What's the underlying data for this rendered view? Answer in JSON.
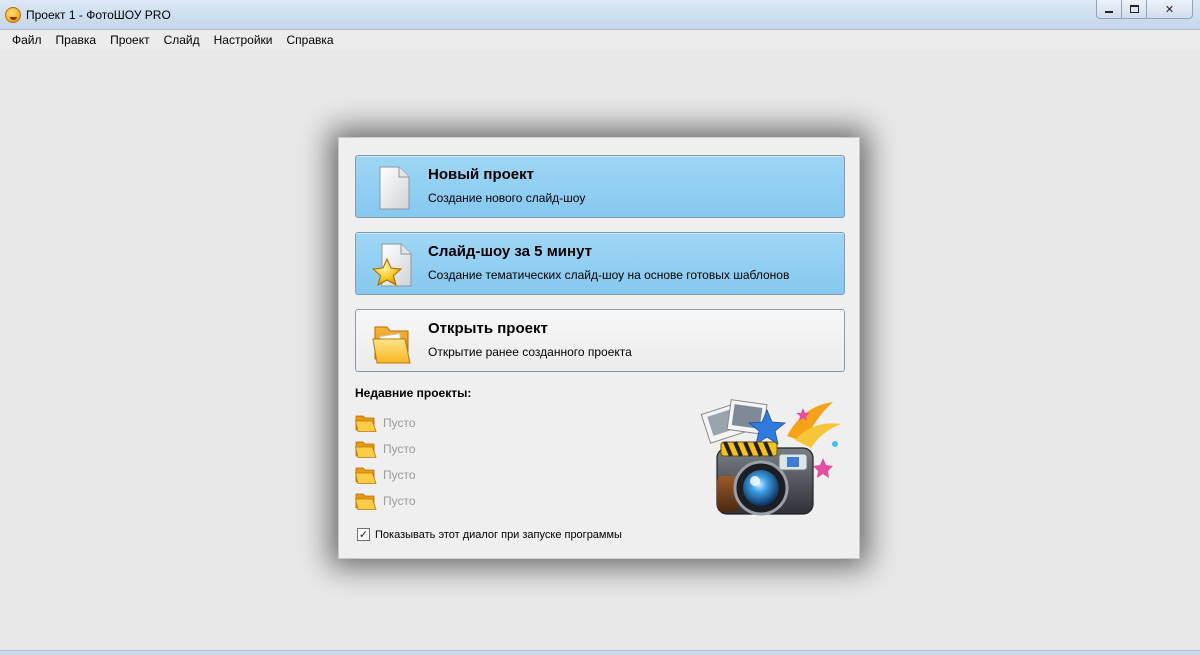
{
  "window": {
    "title": "Проект 1 - ФотоШОУ PRO",
    "controls": {
      "minimize": "minimize-icon",
      "maximize": "maximize-icon",
      "close": "✕"
    }
  },
  "menu": [
    "Файл",
    "Правка",
    "Проект",
    "Слайд",
    "Настройки",
    "Справка"
  ],
  "dialog": {
    "actions": [
      {
        "title": "Новый проект",
        "subtitle": "Создание нового слайд-шоу",
        "icon": "blank-document-icon"
      },
      {
        "title": "Слайд-шоу за 5 минут",
        "subtitle": "Создание тематических слайд-шоу на основе готовых шаблонов",
        "icon": "star-document-icon"
      },
      {
        "title": "Открыть проект",
        "subtitle": "Открытие ранее созданного проекта",
        "icon": "open-folder-icon"
      }
    ],
    "recent": {
      "heading": "Недавние проекты:",
      "items": [
        "Пусто",
        "Пусто",
        "Пусто",
        "Пусто"
      ]
    },
    "show_on_startup": {
      "label": "Показывать этот диалог при запуске программы",
      "checked": true,
      "mark": "✓"
    }
  },
  "colors": {
    "accent_blue": "#8fcdf2",
    "titlebar": "#c9daee",
    "empty_text": "#9b9b9b"
  }
}
